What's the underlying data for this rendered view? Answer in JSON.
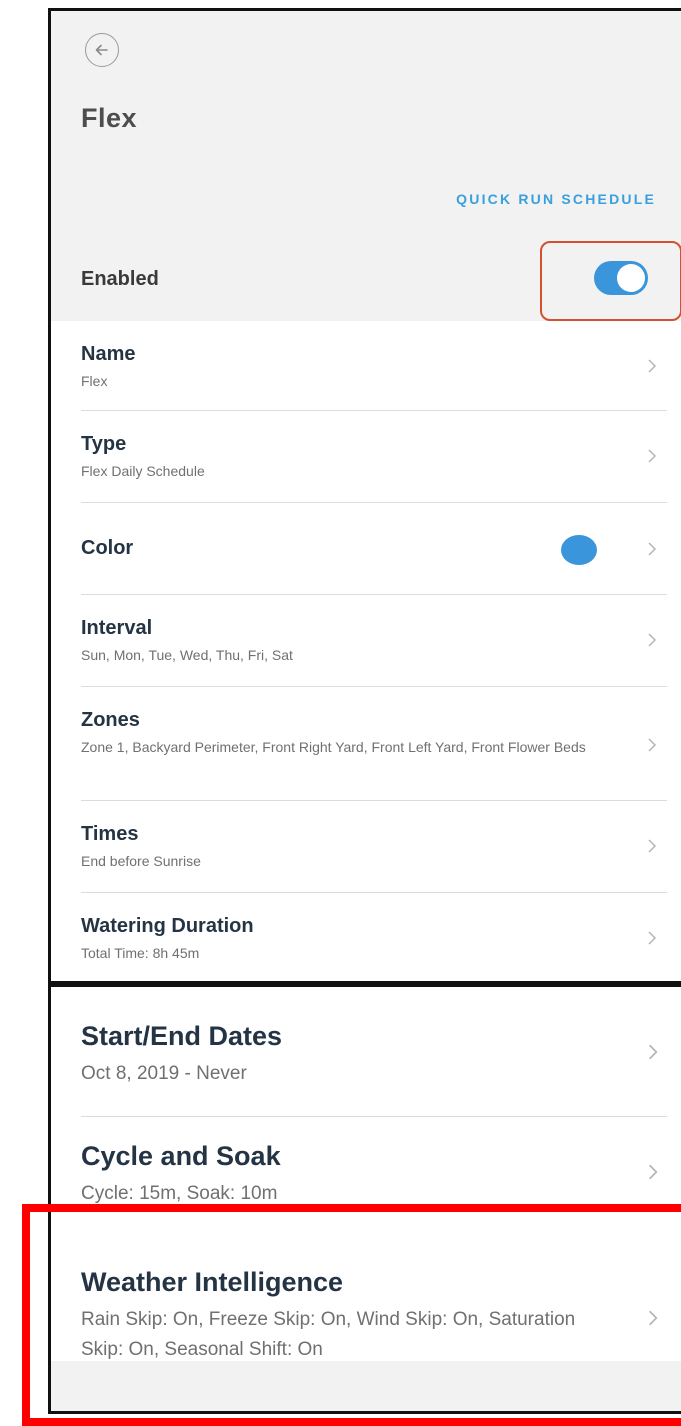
{
  "header": {
    "back_icon": "arrow-left-circle-icon",
    "title": "Flex",
    "quick_run_label": "QUICK RUN SCHEDULE",
    "enabled_label": "Enabled",
    "enabled": true
  },
  "settings": [
    {
      "title": "Name",
      "value": "Flex"
    },
    {
      "title": "Type",
      "value": "Flex Daily Schedule"
    },
    {
      "title": "Color",
      "value": "",
      "color": "#3a95db"
    },
    {
      "title": "Interval",
      "value": "Sun, Mon, Tue, Wed, Thu, Fri, Sat"
    },
    {
      "title": "Zones",
      "value": "Zone 1, Backyard Perimeter, Front Right Yard, Front Left Yard, Front Flower Beds"
    },
    {
      "title": "Times",
      "value": "End before Sunrise"
    },
    {
      "title": "Watering Duration",
      "value": "Total Time: 8h 45m"
    }
  ],
  "more_settings": [
    {
      "title": "Start/End Dates",
      "value": "Oct 8, 2019 - Never"
    },
    {
      "title": "Cycle and Soak",
      "value": "Cycle: 15m, Soak: 10m"
    },
    {
      "title": "Weather Intelligence",
      "value": "Rain Skip: On, Freeze Skip: On, Wind Skip: On, Saturation Skip: On, Seasonal Shift: On"
    }
  ],
  "colors": {
    "accent": "#3aa0dd",
    "toggle_on": "#3a95db",
    "highlight_red": "#ff0000",
    "highlight_orange": "#d2512f"
  }
}
